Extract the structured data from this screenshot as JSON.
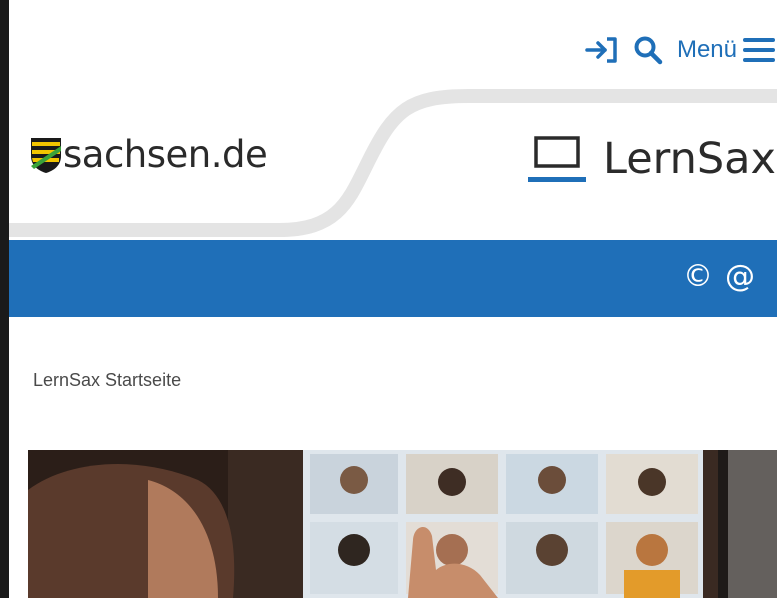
{
  "header": {
    "login_icon": "login-icon",
    "search_icon": "search-icon",
    "menu_label": "Menü",
    "menu_icon": "hamburger-menu-icon",
    "site_logo_text": "sachsen.de",
    "brand_name": "LernSax"
  },
  "service_bar": {
    "icons": [
      "copyright-icon",
      "at-sign-icon"
    ],
    "icon_glyphs": [
      "©",
      "@"
    ],
    "color": "#1f6fb8"
  },
  "breadcrumb": {
    "current": "LernSax Startseite"
  },
  "colors": {
    "accent": "#1f6fb8",
    "text": "#2a2a2a"
  }
}
